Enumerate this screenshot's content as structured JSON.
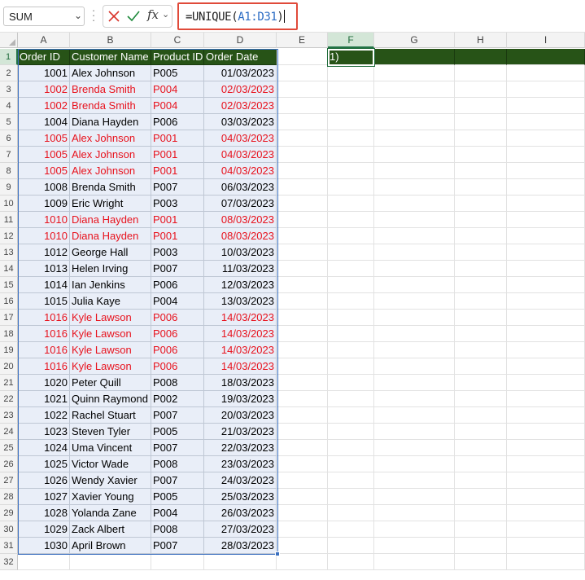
{
  "formula_bar": {
    "name_box": "SUM",
    "formula_prefix": "=UNIQUE(",
    "formula_range": "A1:D31",
    "formula_suffix": ")",
    "fx_label": "fx"
  },
  "columns": [
    "A",
    "B",
    "C",
    "D",
    "E",
    "F",
    "G",
    "H",
    "I"
  ],
  "rows": [
    "1",
    "2",
    "3",
    "4",
    "5",
    "6",
    "7",
    "8",
    "9",
    "10",
    "11",
    "12",
    "13",
    "14",
    "15",
    "16",
    "17",
    "18",
    "19",
    "20",
    "21",
    "22",
    "23",
    "24",
    "25",
    "26",
    "27",
    "28",
    "29",
    "30",
    "31",
    "32"
  ],
  "headers": [
    "Order ID",
    "Customer Name",
    "Product ID",
    "Order Date"
  ],
  "f1_value": "1)",
  "colors": {
    "header_fill": "#275317",
    "duplicate_text": "#e8121d",
    "data_fill": "#e9eef8",
    "highlight_border": "#e04a3a"
  },
  "table": [
    {
      "id": "1001",
      "name": "Alex Johnson",
      "product": "P005",
      "date": "01/03/2023",
      "dup": false
    },
    {
      "id": "1002",
      "name": "Brenda Smith",
      "product": "P004",
      "date": "02/03/2023",
      "dup": true
    },
    {
      "id": "1002",
      "name": "Brenda Smith",
      "product": "P004",
      "date": "02/03/2023",
      "dup": true
    },
    {
      "id": "1004",
      "name": "Diana Hayden",
      "product": "P006",
      "date": "03/03/2023",
      "dup": false
    },
    {
      "id": "1005",
      "name": "Alex Johnson",
      "product": "P001",
      "date": "04/03/2023",
      "dup": true
    },
    {
      "id": "1005",
      "name": "Alex Johnson",
      "product": "P001",
      "date": "04/03/2023",
      "dup": true
    },
    {
      "id": "1005",
      "name": "Alex Johnson",
      "product": "P001",
      "date": "04/03/2023",
      "dup": true
    },
    {
      "id": "1008",
      "name": "Brenda Smith",
      "product": "P007",
      "date": "06/03/2023",
      "dup": false
    },
    {
      "id": "1009",
      "name": "Eric Wright",
      "product": "P003",
      "date": "07/03/2023",
      "dup": false
    },
    {
      "id": "1010",
      "name": "Diana Hayden",
      "product": "P001",
      "date": "08/03/2023",
      "dup": true
    },
    {
      "id": "1010",
      "name": "Diana Hayden",
      "product": "P001",
      "date": "08/03/2023",
      "dup": true
    },
    {
      "id": "1012",
      "name": "George Hall",
      "product": "P003",
      "date": "10/03/2023",
      "dup": false
    },
    {
      "id": "1013",
      "name": "Helen Irving",
      "product": "P007",
      "date": "11/03/2023",
      "dup": false
    },
    {
      "id": "1014",
      "name": "Ian Jenkins",
      "product": "P006",
      "date": "12/03/2023",
      "dup": false
    },
    {
      "id": "1015",
      "name": "Julia Kaye",
      "product": "P004",
      "date": "13/03/2023",
      "dup": false
    },
    {
      "id": "1016",
      "name": "Kyle Lawson",
      "product": "P006",
      "date": "14/03/2023",
      "dup": true
    },
    {
      "id": "1016",
      "name": "Kyle Lawson",
      "product": "P006",
      "date": "14/03/2023",
      "dup": true
    },
    {
      "id": "1016",
      "name": "Kyle Lawson",
      "product": "P006",
      "date": "14/03/2023",
      "dup": true
    },
    {
      "id": "1016",
      "name": "Kyle Lawson",
      "product": "P006",
      "date": "14/03/2023",
      "dup": true
    },
    {
      "id": "1020",
      "name": "Peter Quill",
      "product": "P008",
      "date": "18/03/2023",
      "dup": false
    },
    {
      "id": "1021",
      "name": "Quinn Raymond",
      "product": "P002",
      "date": "19/03/2023",
      "dup": false
    },
    {
      "id": "1022",
      "name": "Rachel Stuart",
      "product": "P007",
      "date": "20/03/2023",
      "dup": false
    },
    {
      "id": "1023",
      "name": "Steven Tyler",
      "product": "P005",
      "date": "21/03/2023",
      "dup": false
    },
    {
      "id": "1024",
      "name": "Uma Vincent",
      "product": "P007",
      "date": "22/03/2023",
      "dup": false
    },
    {
      "id": "1025",
      "name": "Victor Wade",
      "product": "P008",
      "date": "23/03/2023",
      "dup": false
    },
    {
      "id": "1026",
      "name": "Wendy Xavier",
      "product": "P007",
      "date": "24/03/2023",
      "dup": false
    },
    {
      "id": "1027",
      "name": "Xavier Young",
      "product": "P005",
      "date": "25/03/2023",
      "dup": false
    },
    {
      "id": "1028",
      "name": "Yolanda Zane",
      "product": "P004",
      "date": "26/03/2023",
      "dup": false
    },
    {
      "id": "1029",
      "name": "Zack Albert",
      "product": "P008",
      "date": "27/03/2023",
      "dup": false
    },
    {
      "id": "1030",
      "name": "April Brown",
      "product": "P007",
      "date": "28/03/2023",
      "dup": false
    }
  ]
}
